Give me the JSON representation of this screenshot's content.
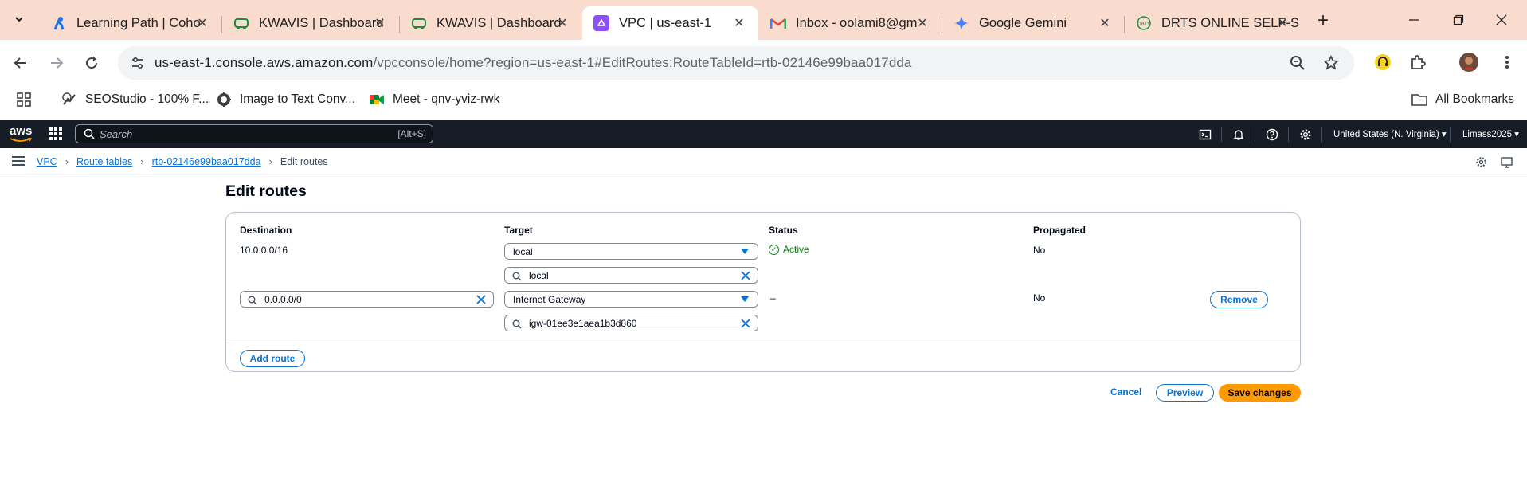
{
  "browser": {
    "tabs": [
      {
        "title": "Learning Path | Coho",
        "favicon": "learning-path-icon"
      },
      {
        "title": "KWAVIS | Dashboard",
        "favicon": "kwavis-icon"
      },
      {
        "title": "KWAVIS | Dashboard",
        "favicon": "kwavis-icon"
      },
      {
        "title": "VPC | us-east-1",
        "favicon": "vpc-icon",
        "active": true
      },
      {
        "title": "Inbox - oolami8@gm",
        "favicon": "gmail-icon"
      },
      {
        "title": "Google Gemini",
        "favicon": "gemini-icon"
      },
      {
        "title": "DRTS ONLINE SELF-S",
        "favicon": "drts-icon"
      }
    ],
    "url_host": "us-east-1.console.aws.amazon.com",
    "url_rest": "/vpcconsole/home?region=us-east-1#EditRoutes:RouteTableId=rtb-02146e99baa017dda",
    "bookmarks": [
      {
        "label": "SEOStudio - 100% F...",
        "icon": "seostudio-icon"
      },
      {
        "label": "Image to Text Conv...",
        "icon": "image-to-text-icon"
      },
      {
        "label": "Meet - qnv-yviz-rwk",
        "icon": "meet-icon"
      }
    ],
    "all_bookmarks_label": "All Bookmarks"
  },
  "aws_nav": {
    "logo": "aws",
    "search_placeholder": "Search",
    "search_shortcut": "[Alt+S]",
    "region": "United States (N. Virginia) ▾",
    "account": "Limass2025 ▾"
  },
  "breadcrumbs": {
    "items": [
      "VPC",
      "Route tables",
      "rtb-02146e99baa017dda"
    ],
    "current": "Edit routes"
  },
  "page": {
    "title": "Edit routes",
    "columns": {
      "destination": "Destination",
      "target": "Target",
      "status": "Status",
      "propagated": "Propagated"
    },
    "routes": [
      {
        "destination": "10.0.0.0/16",
        "target_type": "local",
        "target_value": "local",
        "status": "Active",
        "propagated": "No"
      },
      {
        "destination": "0.0.0.0/0",
        "target_type": "Internet Gateway",
        "target_value": "igw-01ee3e1aea1b3d860",
        "status": "–",
        "propagated": "No",
        "remove_label": "Remove"
      }
    ],
    "add_route_label": "Add route",
    "cancel_label": "Cancel",
    "preview_label": "Preview",
    "save_label": "Save changes"
  },
  "colors": {
    "tabstrip_bg": "#f9dccd",
    "aws_nav_bg": "#161d26",
    "link_blue": "#0972d3",
    "primary_orange": "#ff9900",
    "success_green": "#037f0c"
  }
}
